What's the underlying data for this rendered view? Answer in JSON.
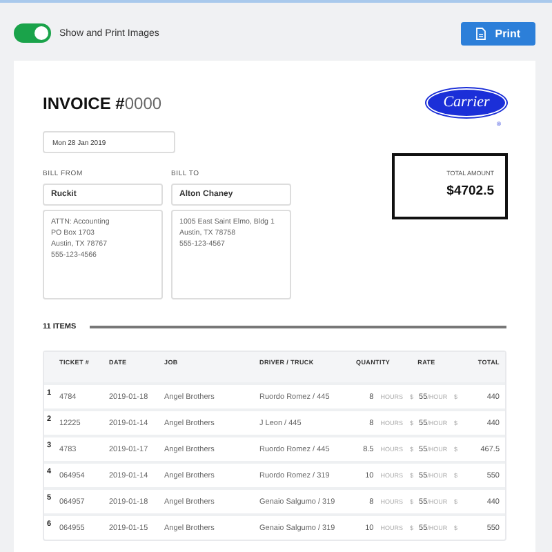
{
  "toolbar": {
    "images_toggle": {
      "label": "Show and Print Images",
      "on": true
    },
    "print_button": "Print"
  },
  "invoice": {
    "title": "INVOICE #",
    "number": "0000",
    "logo_text": "Carrier",
    "logo_mark": "®",
    "date": "Mon 28 Jan 2019",
    "bill_from": {
      "label": "BILL FROM",
      "name": "Ruckit",
      "address": "ATTN: Accounting\nPO Box 1703\nAustin, TX 78767\n555-123-4566"
    },
    "bill_to": {
      "label": "BILL TO",
      "name": "Alton Chaney",
      "address": "1005 East Saint Elmo, Bldg 1\nAustin, TX 78758\n555-123-4567"
    },
    "total": {
      "label": "TOTAL AMOUNT",
      "value": "$4702.5"
    },
    "items_count": "11 ITEMS"
  },
  "table": {
    "columns": [
      "TICKET #",
      "DATE",
      "JOB",
      "DRIVER / TRUCK",
      "QUANTITY",
      "RATE",
      "TOTAL"
    ],
    "rows": [
      {
        "index": "1",
        "ticket": "4784",
        "date": "2019-01-18",
        "job": "Angel Brothers",
        "driver_truck": "Ruordo Romez / 445",
        "quantity": "8",
        "quantity_unit": "HOURS",
        "rate_currency": "$",
        "rate": "55",
        "rate_unit": "/HOUR",
        "total_currency": "$",
        "total": "440"
      },
      {
        "index": "2",
        "ticket": "12225",
        "date": "2019-01-14",
        "job": "Angel Brothers",
        "driver_truck": "J Leon / 445",
        "quantity": "8",
        "quantity_unit": "HOURS",
        "rate_currency": "$",
        "rate": "55",
        "rate_unit": "/HOUR",
        "total_currency": "$",
        "total": "440"
      },
      {
        "index": "3",
        "ticket": "4783",
        "date": "2019-01-17",
        "job": "Angel Brothers",
        "driver_truck": "Ruordo Romez / 445",
        "quantity": "8.5",
        "quantity_unit": "HOURS",
        "rate_currency": "$",
        "rate": "55",
        "rate_unit": "/HOUR",
        "total_currency": "$",
        "total": "467.5"
      },
      {
        "index": "4",
        "ticket": "064954",
        "date": "2019-01-14",
        "job": "Angel Brothers",
        "driver_truck": "Ruordo Romez / 319",
        "quantity": "10",
        "quantity_unit": "HOURS",
        "rate_currency": "$",
        "rate": "55",
        "rate_unit": "/HOUR",
        "total_currency": "$",
        "total": "550"
      },
      {
        "index": "5",
        "ticket": "064957",
        "date": "2019-01-18",
        "job": "Angel Brothers",
        "driver_truck": "Genaio Salgumo / 319",
        "quantity": "8",
        "quantity_unit": "HOURS",
        "rate_currency": "$",
        "rate": "55",
        "rate_unit": "/HOUR",
        "total_currency": "$",
        "total": "440"
      },
      {
        "index": "6",
        "ticket": "064955",
        "date": "2019-01-15",
        "job": "Angel Brothers",
        "driver_truck": "Genaio Salgumo / 319",
        "quantity": "10",
        "quantity_unit": "HOURS",
        "rate_currency": "$",
        "rate": "55",
        "rate_unit": "/HOUR",
        "total_currency": "$",
        "total": "550"
      }
    ]
  }
}
